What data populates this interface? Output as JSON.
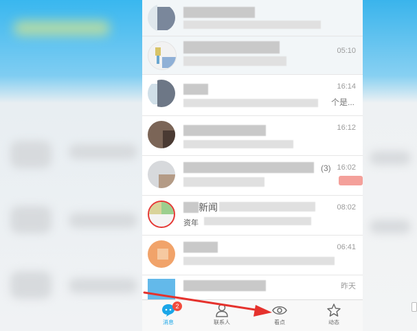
{
  "conversations": [
    {
      "time": "",
      "preview_tail": "",
      "count": ""
    },
    {
      "time": "05:10",
      "preview_tail": "",
      "count": ""
    },
    {
      "time": "16:14",
      "preview_tail": "个是...",
      "count": ""
    },
    {
      "time": "16:12",
      "preview_tail": "",
      "count": ""
    },
    {
      "time": "16:02",
      "preview_tail": "",
      "count": "(3)"
    },
    {
      "time": "08:02",
      "preview_tail": "",
      "count": "",
      "title_fragment": "新闻",
      "subtitle_fragment": "资年"
    },
    {
      "time": "06:41",
      "preview_tail": "",
      "count": ""
    },
    {
      "time": "昨天",
      "preview_tail": "",
      "count": ""
    }
  ],
  "tabbar": {
    "messages": {
      "label": "消息",
      "badge": "2"
    },
    "contacts": {
      "label": "联系人"
    },
    "kandian": {
      "label": "看点"
    },
    "dynamics": {
      "label": "动态"
    }
  },
  "colors": {
    "accent": "#1aa6e8",
    "badge": "#f24b3c",
    "annotation_arrow": "#e5322d"
  },
  "icons": {
    "messages": "chat-bubble-icon",
    "contacts": "person-icon",
    "kandian": "eye-icon",
    "dynamics": "star-icon",
    "annotation": "red-arrow-icon"
  }
}
